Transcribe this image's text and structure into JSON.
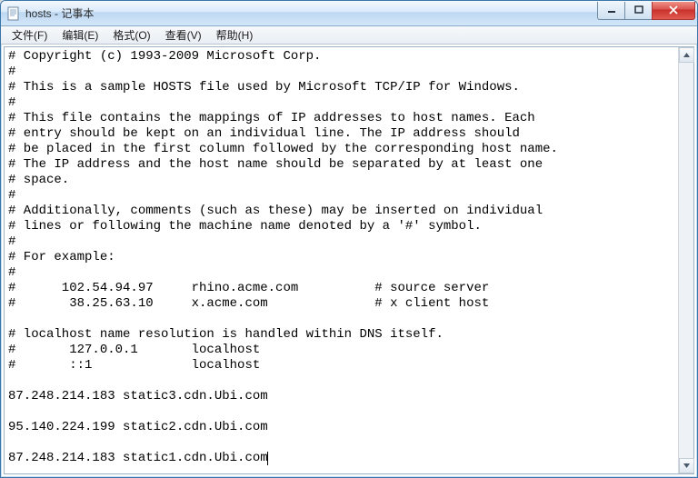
{
  "window": {
    "title": "hosts - 记事本"
  },
  "menu": {
    "file": "文件(F)",
    "edit": "编辑(E)",
    "format": "格式(O)",
    "view": "查看(V)",
    "help": "帮助(H)"
  },
  "editor": {
    "content": "# Copyright (c) 1993-2009 Microsoft Corp.\n#\n# This is a sample HOSTS file used by Microsoft TCP/IP for Windows.\n#\n# This file contains the mappings of IP addresses to host names. Each\n# entry should be kept on an individual line. The IP address should\n# be placed in the first column followed by the corresponding host name.\n# The IP address and the host name should be separated by at least one\n# space.\n#\n# Additionally, comments (such as these) may be inserted on individual\n# lines or following the machine name denoted by a '#' symbol.\n#\n# For example:\n#\n#      102.54.94.97     rhino.acme.com          # source server\n#       38.25.63.10     x.acme.com              # x client host\n\n# localhost name resolution is handled within DNS itself.\n#       127.0.0.1       localhost\n#       ::1             localhost\n\n87.248.214.183 static3.cdn.Ubi.com\n\n95.140.224.199 static2.cdn.Ubi.com\n\n87.248.214.183 static1.cdn.Ubi.com"
  }
}
